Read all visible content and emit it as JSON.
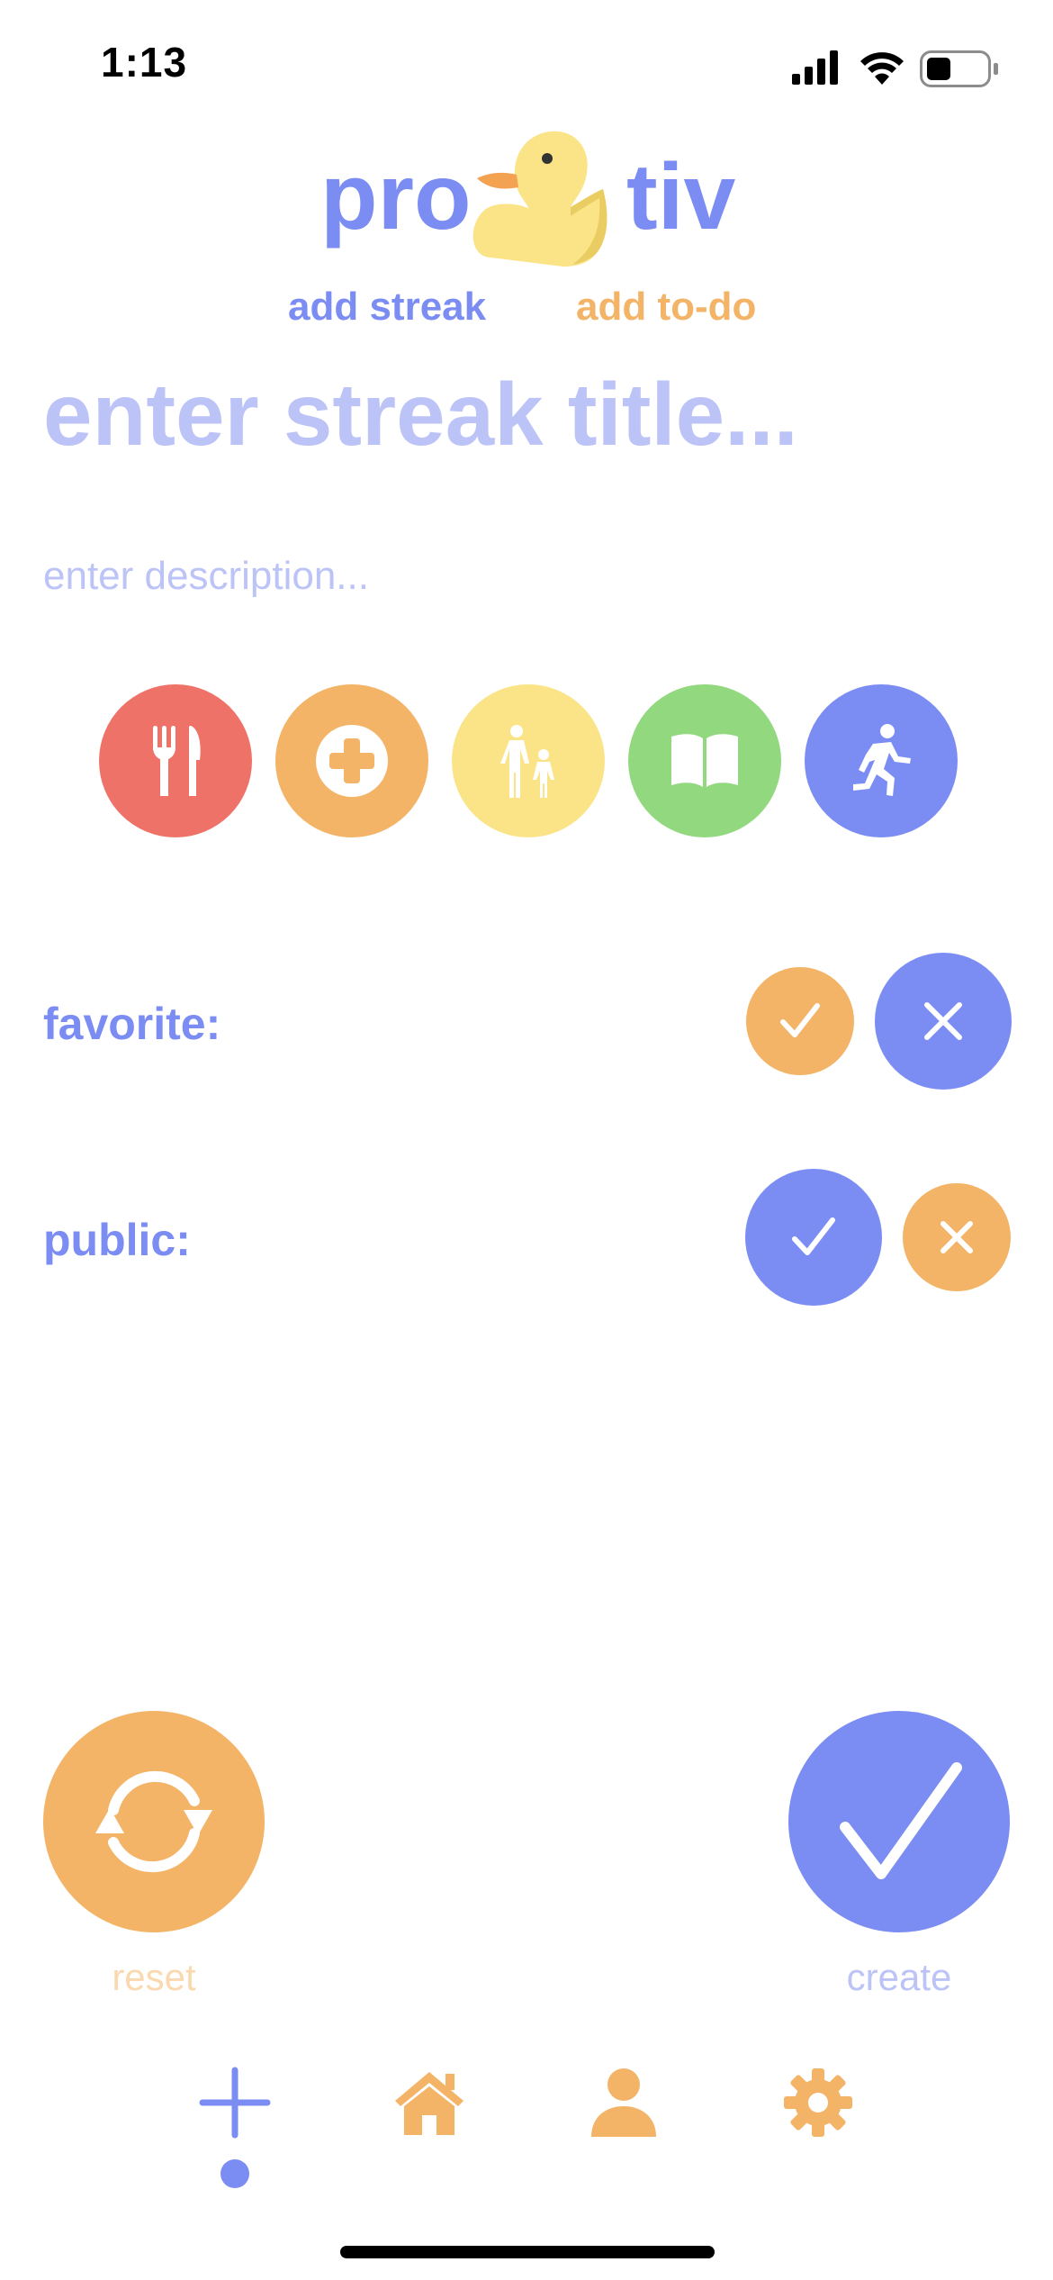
{
  "status_bar": {
    "time": "1:13"
  },
  "header": {
    "logo_left": "pro",
    "logo_right": "tiv",
    "nav_add_streak": "add streak",
    "nav_add_todo": "add to-do"
  },
  "form": {
    "title_placeholder": "enter streak title...",
    "description_placeholder": "enter description..."
  },
  "categories": [
    {
      "name": "food",
      "icon": "fork-knife-icon",
      "color": "#ee7268"
    },
    {
      "name": "health",
      "icon": "medical-cross-icon",
      "color": "#f3b468"
    },
    {
      "name": "family",
      "icon": "family-icon",
      "color": "#fbe488"
    },
    {
      "name": "learning",
      "icon": "book-icon",
      "color": "#92d87f"
    },
    {
      "name": "exercise",
      "icon": "running-icon",
      "color": "#7b8cf3"
    }
  ],
  "options": {
    "favorite_label": "favorite:",
    "public_label": "public:"
  },
  "actions": {
    "reset_label": "reset",
    "create_label": "create"
  },
  "colors": {
    "accent_blue": "#7b8cf3",
    "accent_orange": "#f3b468",
    "placeholder": "#bcc3f6"
  }
}
